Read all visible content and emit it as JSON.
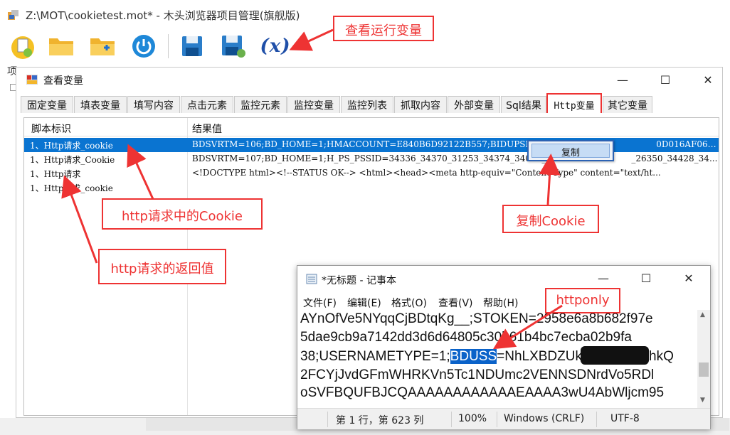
{
  "main": {
    "title": "Z:\\MOT\\cookietest.mot* - 木头浏览器项目管理(旗舰版)",
    "side_label": "项",
    "toolbar": {
      "buttons": [
        "new-project-icon",
        "open-folder-icon",
        "add-folder-icon",
        "power-icon",
        "save-icon",
        "save-as-icon"
      ],
      "var_button_text": "(x)"
    }
  },
  "var_dialog": {
    "title": "查看变量",
    "controls": {
      "minimize": "—",
      "maximize": "☐",
      "close": "✕"
    },
    "tabs": [
      "固定变量",
      "填表变量",
      "填写内容",
      "点击元素",
      "监控元素",
      "监控变量",
      "监控列表",
      "抓取内容",
      "外部变量",
      "Sql结果",
      "Http变量",
      "其它变量"
    ],
    "active_tab": "Http变量",
    "columns": [
      "脚本标识",
      "结果值"
    ],
    "rows": [
      {
        "id": "1、Http请求_cookie",
        "value": "BDSVRTM=106;BD_HOME=1;HMACCOUNT=E840B6D92122B557;BIDUPSID=698E1",
        "value_tail": "0D016AF06E;PSTM...",
        "selected": true
      },
      {
        "id": "1、Http请求_Cookie",
        "value": "BDSVRTM=107;BD_HOME=1;H_PS_PSSID=34336_34370_31253_34374_34004_",
        "value_tail": "_26350_34428_34..."
      },
      {
        "id": "1、Http请求",
        "value": "<!DOCTYPE html><!--STATUS OK-->   <html><head><meta http-equiv=\"Content-Type\" content=\"text/ht..."
      },
      {
        "id": "1、Http请求_cookie",
        "value": ""
      }
    ],
    "context_menu": [
      "复制"
    ]
  },
  "notepad": {
    "title": "*无标题 - 记事本",
    "menu": [
      "文件(F)",
      "编辑(E)",
      "格式(O)",
      "查看(V)",
      "帮助(H)"
    ],
    "lines": [
      "AYnOfVe5NYqqCjBDtqKg__;STOKEN=2958e6a8b682f97e",
      "5dae9cb9a7142dd3d6d64805c30b61b4bc7ecba02b9fa",
      "2FCYjJvdGFmWHRKVn5Tc1NDUmc2VENNSDNrdVo5RDl",
      "oSVFBQUFBJCQAAAAAAAAAAAAEAAAA3wU4AbWljcm95"
    ],
    "line3_prefix": "38;USERNAMETYPE=1;",
    "line3_highlight": "BDUSS",
    "line3_suffix": "=NhLXBDZUk",
    "line3_tail": "hkQ",
    "status": {
      "position": "第 1 行，第 623 列",
      "zoom": "100%",
      "eol": "Windows (CRLF)",
      "encoding": "UTF-8"
    }
  },
  "annotations": {
    "view_vars": "查看运行变量",
    "cookie": "http请求中的Cookie",
    "return_value": "http请求的返回值",
    "copy_cookie": "复制Cookie",
    "httponly": "httponly"
  },
  "colors": {
    "annotation": "#ee3333",
    "selection": "#0a74d1",
    "highlight": "#0a62c9"
  }
}
